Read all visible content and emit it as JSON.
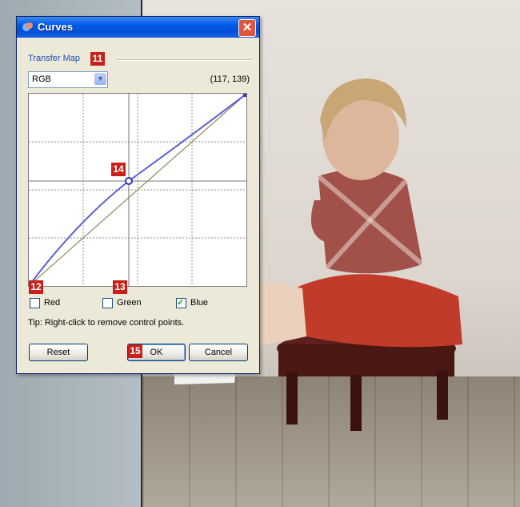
{
  "dialog": {
    "title": "Curves",
    "group_label": "Transfer Map",
    "channel_select": {
      "selected": "RGB",
      "options": [
        "RGB"
      ]
    },
    "coordinates": "(117, 139)",
    "checkboxes": [
      {
        "label": "Red",
        "checked": false
      },
      {
        "label": "Green",
        "checked": false
      },
      {
        "label": "Blue",
        "checked": true
      }
    ],
    "tip": "Tip: Right-click to remove control points.",
    "buttons": {
      "reset": "Reset",
      "ok": "OK",
      "cancel": "Cancel"
    },
    "close_icon": "close-icon"
  },
  "callouts": [
    "11",
    "12",
    "13",
    "14",
    "15"
  ],
  "colors": {
    "titlebar": "#0058e6",
    "curve": "#5a5fd4",
    "diagonal": "#8e8a5a",
    "callout": "#c8211c"
  }
}
